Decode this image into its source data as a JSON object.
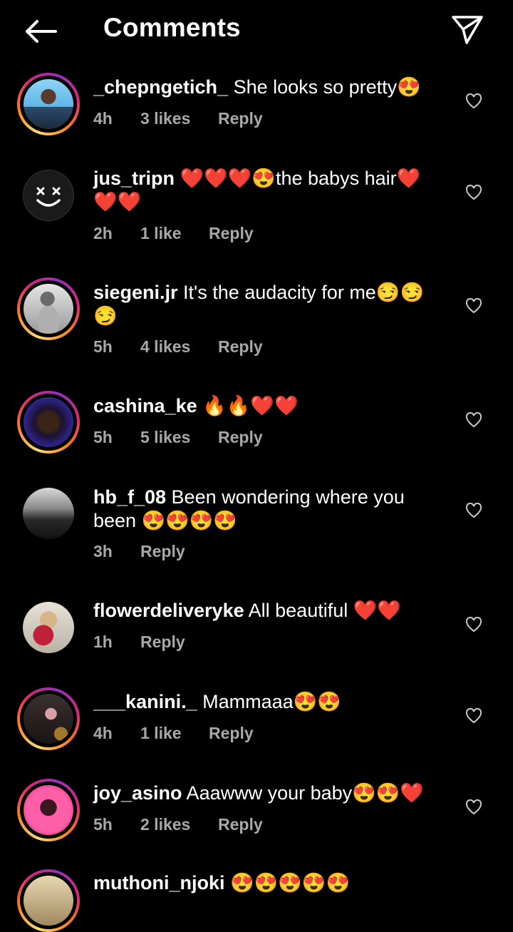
{
  "header": {
    "title": "Comments",
    "back_icon": "arrow-left-icon",
    "share_icon": "send-icon"
  },
  "comments": [
    {
      "username": "_chepngetich_",
      "text": " She looks so pretty😍",
      "time": "4h",
      "likes": "3 likes",
      "reply": "Reply"
    },
    {
      "username": "jus_tripn",
      "text": " ❤️❤️❤️😍the  babys hair❤️❤️❤️",
      "time": "2h",
      "likes": "1 like",
      "reply": "Reply"
    },
    {
      "username": "siegeni.jr",
      "text": " It's the audacity for me😏😏😏",
      "time": "5h",
      "likes": "4 likes",
      "reply": "Reply"
    },
    {
      "username": "cashina_ke",
      "text": " 🔥🔥❤️❤️",
      "time": "5h",
      "likes": "5 likes",
      "reply": "Reply"
    },
    {
      "username": "hb_f_08",
      "text": " Been wondering where you been 😍😍😍😍",
      "time": "3h",
      "likes": "",
      "reply": "Reply"
    },
    {
      "username": "flowerdeliveryke",
      "text": " All beautiful ❤️❤️",
      "time": "1h",
      "likes": "",
      "reply": "Reply"
    },
    {
      "username": "___kanini._",
      "text": " Mammaaa😍😍",
      "time": "4h",
      "likes": "1 like",
      "reply": "Reply"
    },
    {
      "username": "joy_asino",
      "text": " Aaawww your baby😍😍❤️",
      "time": "5h",
      "likes": "2 likes",
      "reply": "Reply"
    },
    {
      "username": "muthoni_njoki",
      "text": " 😍😍😍😍😍",
      "time": "",
      "likes": "",
      "reply": ""
    }
  ],
  "colors": {
    "background": "#000000",
    "meta": "#a8a8a8",
    "heart_emoji": "#e0245e"
  }
}
